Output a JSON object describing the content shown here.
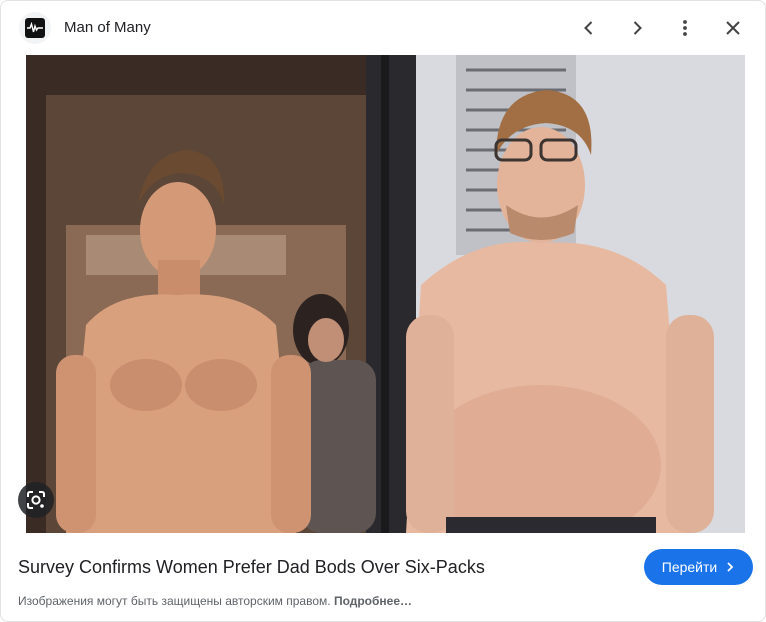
{
  "header": {
    "site_name": "Man of Many",
    "favicon_icon": "waveform-logo-icon",
    "controls": {
      "prev_icon": "chevron-left-icon",
      "next_icon": "chevron-right-icon",
      "more_icon": "more-vert-icon",
      "close_icon": "close-icon"
    }
  },
  "image": {
    "lens_icon": "google-lens-icon"
  },
  "result": {
    "title": "Survey Confirms Women Prefer Dad Bods Over Six-Packs",
    "visit_label": "Перейти",
    "visit_icon": "chevron-right-icon",
    "copyright_text": "Изображения могут быть защищены авторским правом.",
    "more_link": "Подробнее…"
  },
  "colors": {
    "accent": "#1a73e8",
    "text": "#202124",
    "muted": "#5f6368"
  }
}
